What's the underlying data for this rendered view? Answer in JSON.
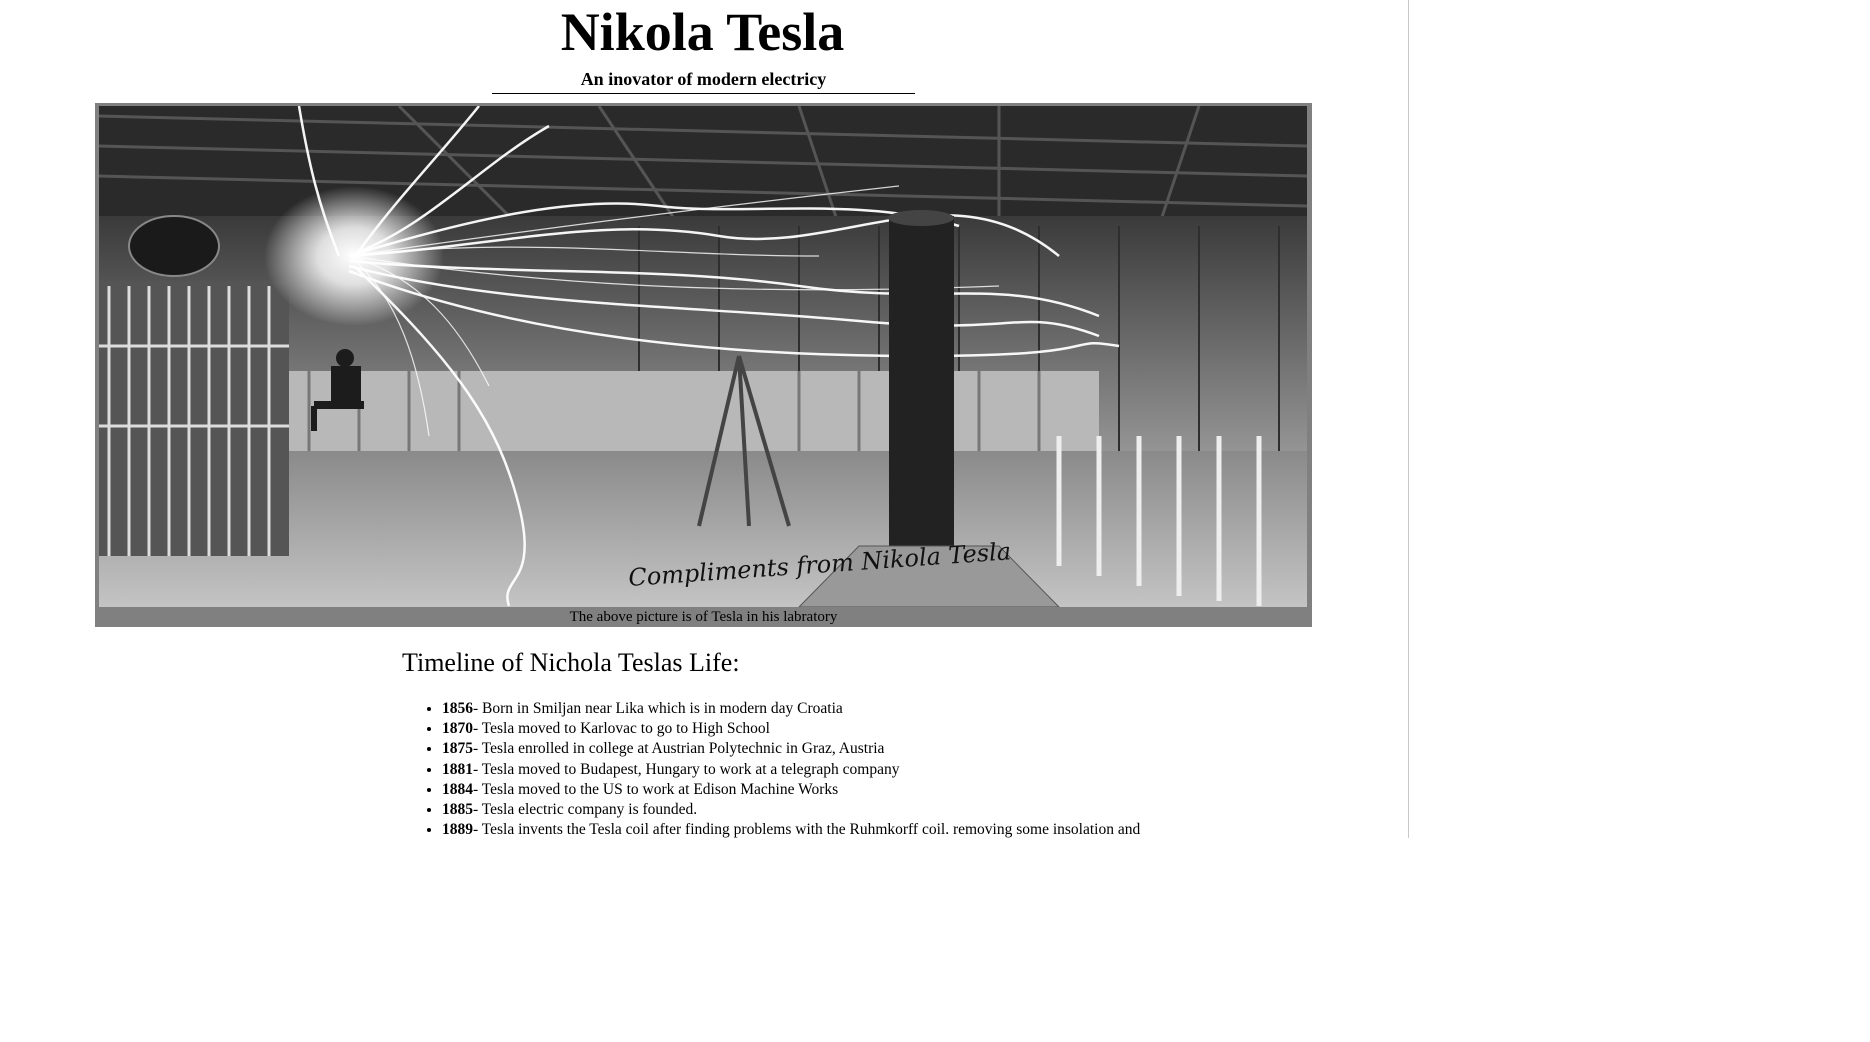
{
  "page": {
    "title": "Nikola Tesla",
    "subtitle": "An inovator of modern electricy"
  },
  "figure": {
    "image_description_icon": "tesla-lab-photo",
    "signature_text": "Compliments from Nikola Tesla",
    "caption": "The above picture is of Tesla in his labratory"
  },
  "timeline": {
    "heading": "Timeline of Nichola Teslas Life:",
    "items": [
      {
        "year": "1856",
        "text": "- Born in Smiljan near Lika which is in modern day Croatia"
      },
      {
        "year": "1870",
        "text": "- Tesla moved to Karlovac to go to High School"
      },
      {
        "year": "1875",
        "text": "- Tesla enrolled in college at Austrian Polytechnic in Graz, Austria"
      },
      {
        "year": "1881",
        "text": "- Tesla moved to Budapest, Hungary to work at a telegraph company"
      },
      {
        "year": "1884",
        "text": "- Tesla moved to the US to work at Edison Machine Works"
      },
      {
        "year": "1885",
        "text": "- Tesla electric company is founded."
      },
      {
        "year": "1889",
        "text": "- Tesla invents the Tesla coil after finding problems with the Ruhmkorff coil. removing some insolation and"
      }
    ]
  },
  "colors": {
    "frame_gray": "#808080",
    "text": "#000000",
    "background": "#ffffff"
  }
}
